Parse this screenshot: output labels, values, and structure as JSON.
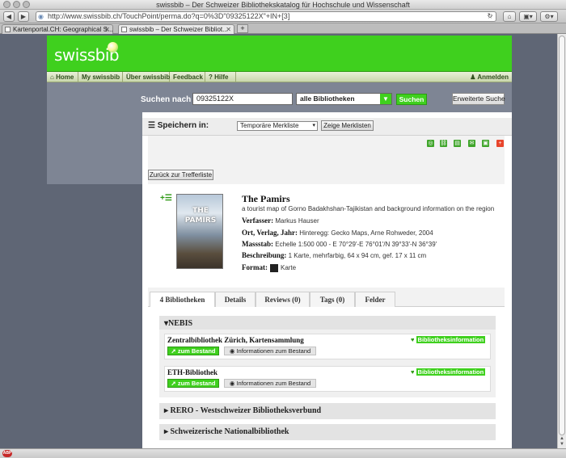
{
  "window": {
    "title": "swissbib – Der Schweizer Bibliothekskatalog für Hochschule und Wissenschaft"
  },
  "browser": {
    "url": "http://www.swissbib.ch/TouchPoint/perma.do?q=0%3D\"09325122X\"+IN+[3]",
    "tabs": [
      {
        "label": "Kartenportal.CH: Geographical S..."
      },
      {
        "label": "swissbib – Der Schweizer Bibliot..."
      }
    ],
    "new_tab": "+"
  },
  "site": {
    "logo": "swissbib",
    "menu": [
      "Home",
      "My swissbib",
      "Über swissbib",
      "Feedback",
      "Hilfe"
    ],
    "login": "Anmelden"
  },
  "search": {
    "label": "Suchen nach",
    "query": "09325122X",
    "library": "alle Bibliotheken",
    "submit": "Suchen",
    "advanced": "Erweiterte Suche"
  },
  "save": {
    "label": "Speichern in:",
    "list": "Temporäre Merkliste",
    "show": "Zeige Merklisten"
  },
  "back": "Zurück zur Trefferliste",
  "record": {
    "cover_text": "THE PAMIRS",
    "title": "The Pamirs",
    "subtitle": "a tourist map of Gorno Badakhshan-Tajikistan and background information on the region",
    "fields": [
      {
        "label": "Verfasser:",
        "value": "Markus Hauser"
      },
      {
        "label": "Ort, Verlag, Jahr:",
        "value": "Hinteregg: Gecko Maps, Arne Rohweder, 2004"
      },
      {
        "label": "Massstab:",
        "value": "Echelle 1:500 000  - E 70°29'-E 76°01'/N 39°33'-N 36°39'"
      },
      {
        "label": "Beschreibung:",
        "value": "1 Karte, mehrfarbig, 64 x 94 cm, gef. 17 x 11 cm"
      },
      {
        "label": "Format:",
        "value": "Karte"
      }
    ]
  },
  "detail_tabs": [
    {
      "count": "4",
      "label": "Bibliotheken"
    },
    {
      "label": "Details"
    },
    {
      "label": "Reviews (0)"
    },
    {
      "label": "Tags (0)"
    },
    {
      "label": "Felder"
    }
  ],
  "groups": [
    {
      "name": "NEBIS",
      "expanded": true
    },
    {
      "name": "RERO - Westschweizer Bibliotheksverbund",
      "expanded": false
    },
    {
      "name": "Schweizerische Nationalbibliothek",
      "expanded": false
    }
  ],
  "libraries": [
    {
      "name": "Zentralbibliothek Zürich, Kartensammlung",
      "info": "Bibliotheksinformation",
      "stock": "zum Bestand",
      "stock_info": "Informationen zum Bestand"
    },
    {
      "name": "ETH-Bibliothek",
      "info": "Bibliotheksinformation",
      "stock": "zum Bestand",
      "stock_info": "Informationen zum Bestand"
    }
  ],
  "colors": {
    "brand_green": "#3fd01e",
    "page_grey": "#5f6675"
  },
  "statusbar": {
    "abp": "ABP"
  }
}
